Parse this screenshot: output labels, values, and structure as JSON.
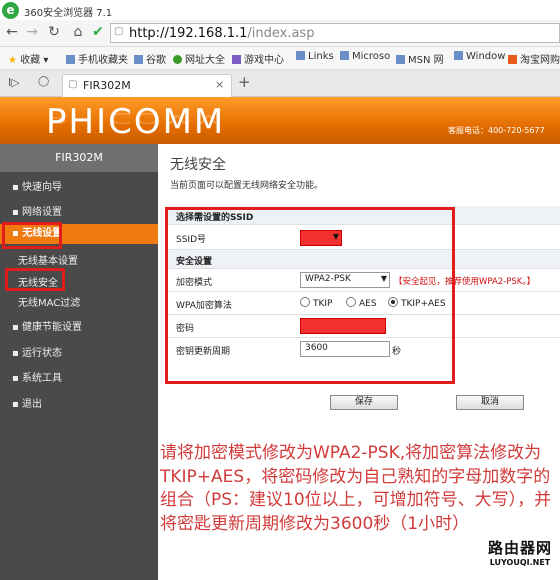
{
  "browser": {
    "title": "360安全浏览器 7.1",
    "url_host": "http://192.168.1.1",
    "url_path": "/index.asp",
    "bookmarks": [
      "收藏",
      "手机收藏夹",
      "谷歌",
      "网址大全",
      "游戏中心",
      "Links",
      "Microso",
      "MSN 网",
      "Window",
      "淘宝网购"
    ],
    "tab_title": "FIR302M"
  },
  "header": {
    "logo": "PHICOMM",
    "hotline": "客服电话：400-720-5677"
  },
  "sidebar": {
    "model": "FIR302M",
    "items": [
      {
        "label": "快速向导"
      },
      {
        "label": "网络设置"
      },
      {
        "label": "无线设置"
      },
      {
        "label": "无线基本设置"
      },
      {
        "label": "无线安全"
      },
      {
        "label": "无线MAC过滤"
      },
      {
        "label": "健康节能设置"
      },
      {
        "label": "运行状态"
      },
      {
        "label": "系统工具"
      },
      {
        "label": "退出"
      }
    ]
  },
  "main": {
    "title": "无线安全",
    "description": "当前页面可以配置无线网络安全功能。",
    "ssid_section": "选择需设置的SSID",
    "ssid_label": "SSID号",
    "security_section": "安全设置",
    "mode_label": "加密模式",
    "mode_value": "WPA2-PSK",
    "mode_hint": "【安全起见，推荐使用WPA2-PSK。】",
    "algo_label": "WPA加密算法",
    "algo_options": [
      "TKIP",
      "AES",
      "TKIP+AES"
    ],
    "algo_selected": "TKIP+AES",
    "password_label": "密码",
    "renew_label": "密钥更新周期",
    "renew_value": "3600",
    "renew_unit": "秒",
    "save_button": "保存",
    "cancel_button": "取消"
  },
  "annotation": "请将加密模式修改为WPA2-PSK,将加密算法修改为TKIP+AES，将密码修改为自己熟知的字母加数字的组合（PS：建议10位以上，可增加符号、大写），并将密匙更新周期修改为3600秒（1小时）",
  "watermark": {
    "cn": "路由器网",
    "en": "LUYOUQI.NET"
  },
  "colors": {
    "accent": "#f07a10",
    "highlight": "#e21b1b",
    "annotation": "#d23b3b"
  }
}
